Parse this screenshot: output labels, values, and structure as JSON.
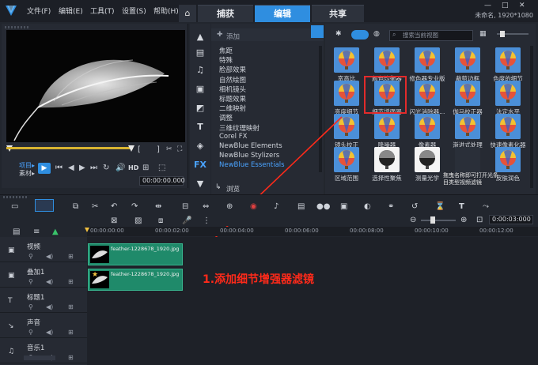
{
  "menubar": {
    "items": [
      "文件(F)",
      "编辑(E)",
      "工具(T)",
      "设置(S)",
      "帮助(H)"
    ],
    "tabs": [
      "捕获",
      "编辑",
      "共享"
    ],
    "active_tab": "编辑",
    "project_info": "未命名, 1920*1080"
  },
  "player": {
    "project_label": "项目▸",
    "clip_label": "素材▸",
    "hd_label": "HD",
    "timecode": "00:00:00.000",
    "bracket_in": "[",
    "bracket_out": "]"
  },
  "library": {
    "add_label": "添加",
    "categories": [
      "焦距",
      "特殊",
      "脸部效果",
      "自然绘图",
      "相机镜头",
      "标题效果",
      "二维映射",
      "调整",
      "三维纹理映射",
      "Corel FX",
      "NewBlue Elements",
      "NewBlue Stylizers",
      "NewBlue Essentials"
    ],
    "selected_category": "NewBlue Essentials",
    "browse_label": "浏览"
  },
  "filters": {
    "search_placeholder": "搜索当前视图",
    "items": [
      "宽高比",
      "颜色均衡器",
      "修色器专业版",
      "裁剪边框",
      "色度的细节",
      "亮度细节",
      "细节增强器",
      "闪光消除器...",
      "伽马校正器",
      "法定水平",
      "镜头校正",
      "降噪器",
      "像素器",
      "渐进式处理",
      "快速像素化器",
      "区域范围",
      "选择性聚焦",
      "测量光学",
      "",
      "皮肤润色"
    ],
    "highlighted": "细节增强器",
    "tooltip": "拖曳名称即可打开光条目类型视频滤镜"
  },
  "timeline": {
    "ruler_ticks": [
      "00:00:00:00",
      "00:00:02:00",
      "00:00:04:00",
      "00:00:06:00",
      "00:00:08:00",
      "00:00:10:00",
      "00:00:12:00"
    ],
    "timecode": "0:00:03:000",
    "tracks": [
      {
        "name": "视频",
        "clip": "feather-1228678_1920.jpg"
      },
      {
        "name": "叠加1",
        "clip": "feather-1228678_1920.jpg"
      },
      {
        "name": "标题1",
        "clip": ""
      },
      {
        "name": "声音",
        "clip": ""
      },
      {
        "name": "音乐1",
        "clip": ""
      }
    ],
    "annotation": "1.添加细节增强器滤镜"
  },
  "colors": {
    "accent": "#2f8ee0",
    "highlight": "#e22b2b",
    "clip": "#1f8a6a"
  }
}
